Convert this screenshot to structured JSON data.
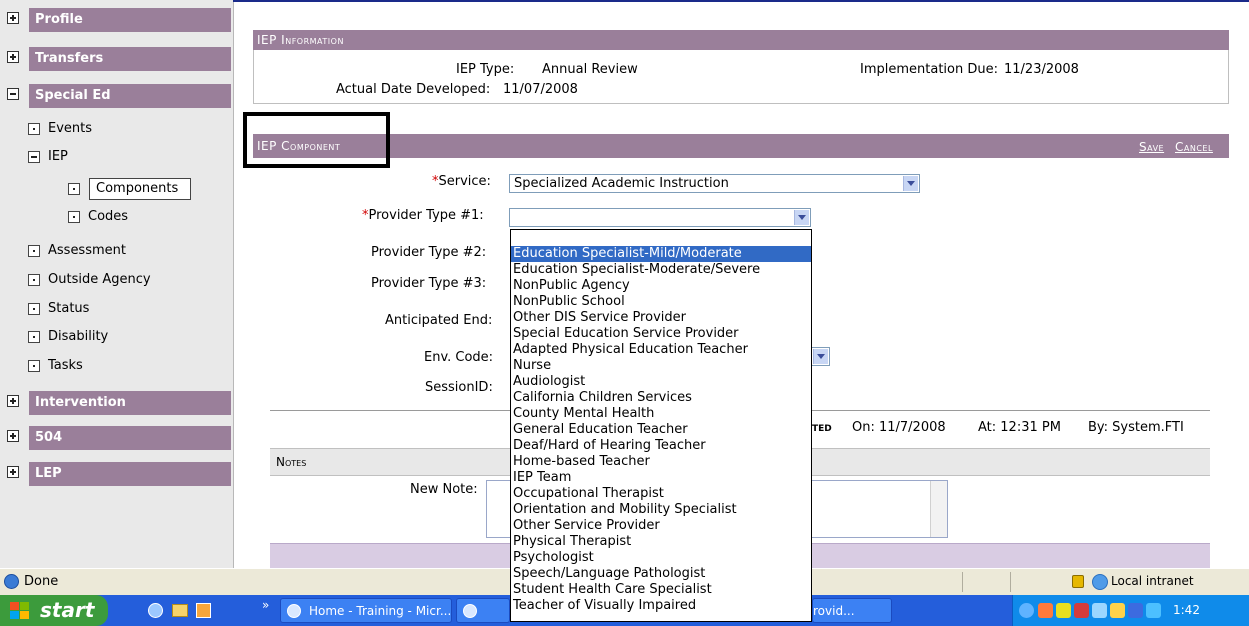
{
  "sidebar": {
    "sections": [
      {
        "label": "Profile",
        "expanded": false
      },
      {
        "label": "Transfers",
        "expanded": false
      },
      {
        "label": "Special Ed",
        "expanded": true
      },
      {
        "label": "Intervention",
        "expanded": false
      },
      {
        "label": "504",
        "expanded": false
      },
      {
        "label": "LEP",
        "expanded": false
      }
    ],
    "special_ed_items": {
      "events": "Events",
      "iep": "IEP",
      "components": "Components",
      "codes": "Codes",
      "assessment": "Assessment",
      "outside_agency": "Outside Agency",
      "status": "Status",
      "disability": "Disability",
      "tasks": "Tasks"
    }
  },
  "iep_info": {
    "header": "IEP Information",
    "iep_type_label": "IEP Type:",
    "iep_type_value": "Annual Review",
    "implementation_due_label": "Implementation Due:",
    "implementation_due_value": "11/23/2008",
    "actual_date_label": "Actual Date Developed:",
    "actual_date_value": "11/07/2008"
  },
  "iep_component": {
    "header": "IEP Component",
    "save_label": "Save",
    "cancel_label": "Cancel",
    "service_label": "Service:",
    "service_value": "Specialized Academic Instruction",
    "provider1_label": "Provider Type #1:",
    "provider1_value": "",
    "provider2_label": "Provider Type #2:",
    "provider3_label": "Provider Type #3:",
    "anticipated_end_label": "Anticipated End:",
    "env_code_label": "Env. Code:",
    "session_id_label": "SessionID:",
    "created_label": "ted",
    "created_on": "On: 11/7/2008",
    "created_at": "At: 12:31 PM",
    "created_by": "By: System.FTI"
  },
  "provider_options": [
    "",
    "Education Specialist-Mild/Moderate",
    "Education Specialist-Moderate/Severe",
    "NonPublic Agency",
    "NonPublic School",
    "Other DIS Service Provider",
    "Special Education Service Provider",
    "Adapted Physical Education Teacher",
    "Nurse",
    "Audiologist",
    "California Children Services",
    "County Mental Health",
    "General Education Teacher",
    "Deaf/Hard of Hearing Teacher",
    "Home-based Teacher",
    "IEP Team",
    "Occupational Therapist",
    "Orientation and Mobility Specialist",
    "Other Service Provider",
    "Physical Therapist",
    "Psychologist",
    "Speech/Language Pathologist",
    "Student Health Care Specialist",
    "Teacher of Visually Impaired"
  ],
  "highlighted_option_index": 1,
  "notes": {
    "header": "Notes",
    "new_note_label": "New Note:"
  },
  "statusbar": {
    "status": "Done",
    "zone": "Local intranet"
  },
  "taskbar": {
    "start_label": "start",
    "tasks": [
      "Home - Training - Micr...",
      "",
      "rovid..."
    ],
    "chevron": "»",
    "clock": "1:42"
  },
  "colors": {
    "header_purple": "#9a7f9a",
    "selection_blue": "#316ac5",
    "taskbar_blue": "#245edb",
    "start_green": "#3c9b3c",
    "required_red": "#d00000"
  }
}
